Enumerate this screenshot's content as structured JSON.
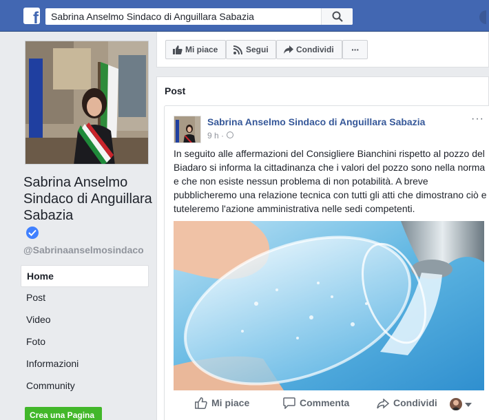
{
  "search": {
    "value": "Sabrina Anselmo Sindaco di Anguillara Sabazia"
  },
  "page": {
    "title": "Sabrina Anselmo Sindaco di Anguillara Sabazia",
    "handle": "@Sabrinaanselmosindaco"
  },
  "nav": {
    "items": [
      {
        "label": "Home"
      },
      {
        "label": "Post"
      },
      {
        "label": "Video"
      },
      {
        "label": "Foto"
      },
      {
        "label": "Informazioni"
      },
      {
        "label": "Community"
      }
    ],
    "create_label": "Crea una Pagina"
  },
  "actions": {
    "like_label": "Mi piace",
    "follow_label": "Segui",
    "share_label": "Condividi",
    "more_label": "···"
  },
  "posts_section": {
    "heading": "Post",
    "post": {
      "author": "Sabrina Anselmo Sindaco di Anguillara Sabazia",
      "time": "9 h ·",
      "text": "In seguito alle affermazioni del Consigliere Bianchini rispetto al pozzo del Biadaro si informa la cittadinanza che i valori del pozzo sono nella norma e che non esiste nessun problema di non potabilità. A breve pubblicheremo una relazione tecnica con tutti gli atti che dimostrano ciò e tuteleremo l'azione amministrativa nelle sedi competenti.",
      "more_label": "···",
      "like_label": "Mi piace",
      "comment_label": "Commenta",
      "share_label": "Condividi"
    }
  },
  "colors": {
    "brand": "#4267b2",
    "link": "#365899",
    "create_button": "#42b72a"
  }
}
